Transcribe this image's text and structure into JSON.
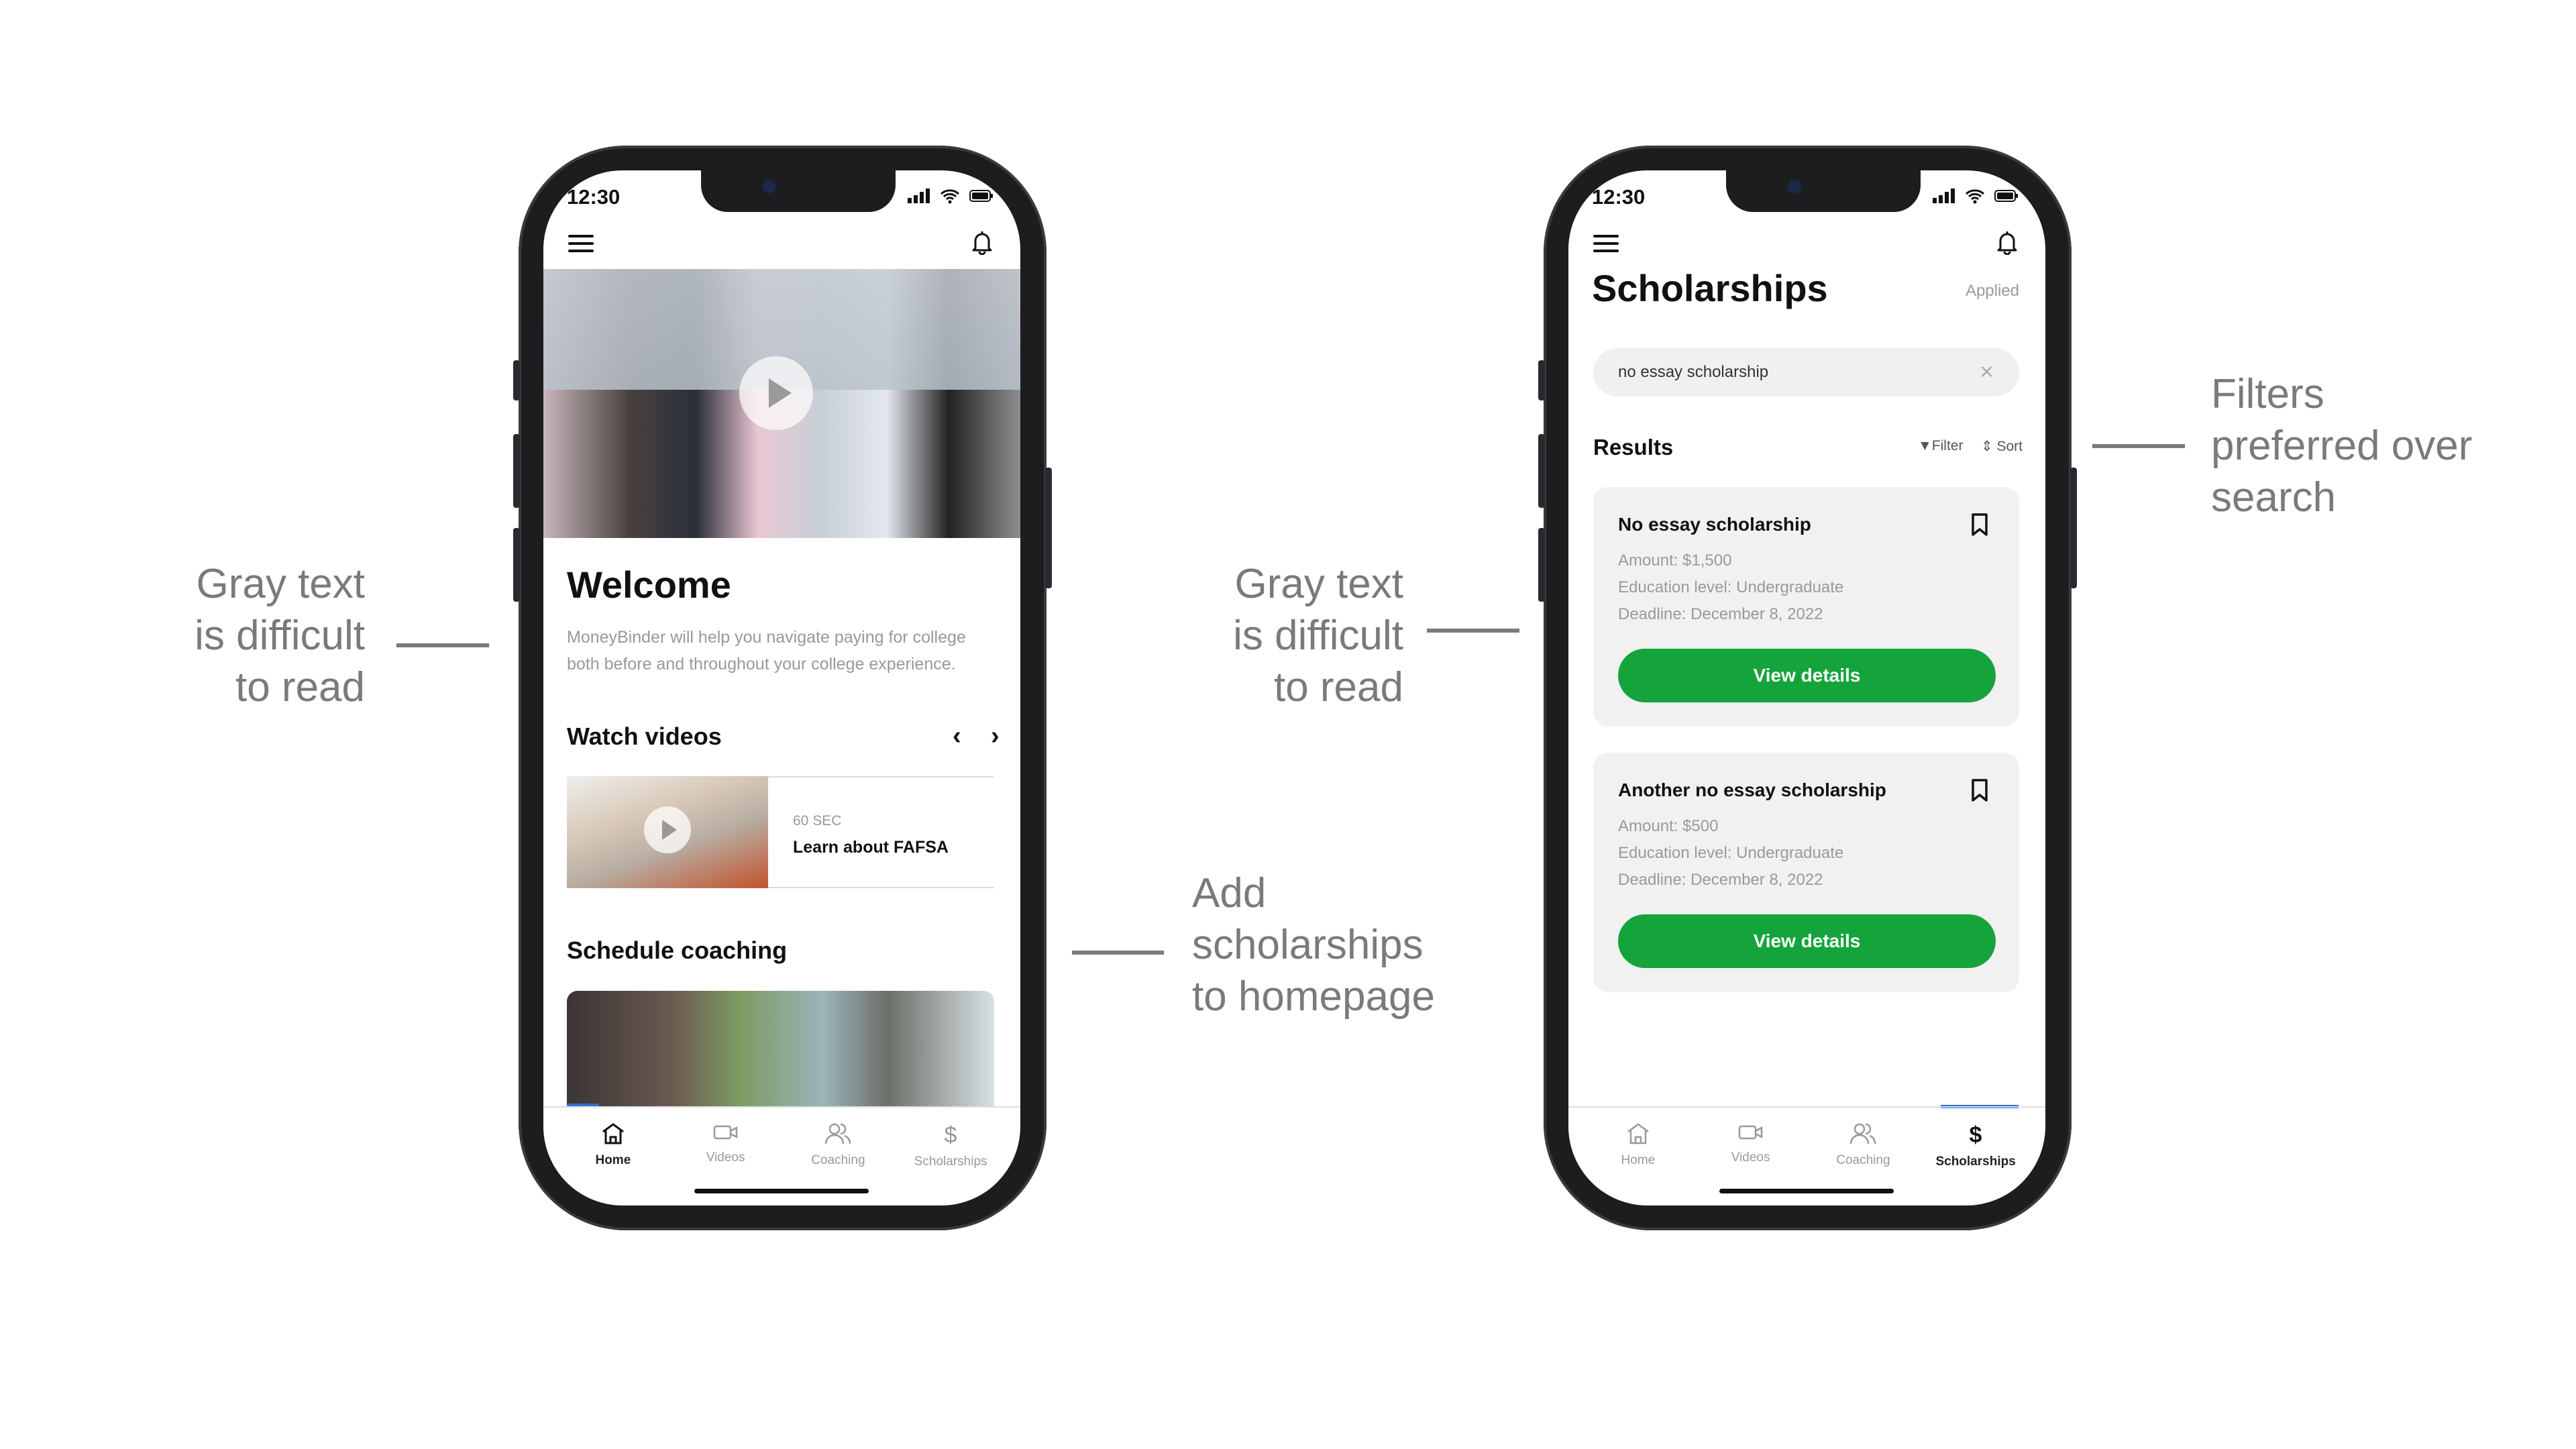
{
  "annotations": [
    {
      "lines": [
        "Gray text",
        "is difficult",
        "to read"
      ]
    },
    {
      "lines": [
        "Gray text",
        "is difficult",
        "to read"
      ]
    },
    {
      "lines": [
        "Add",
        "scholarships",
        "to homepage"
      ]
    },
    {
      "lines": [
        "Filters",
        "preferred over",
        "search"
      ]
    }
  ],
  "status_time": "12:30",
  "nav": [
    "Home",
    "Videos",
    "Coaching",
    "Scholarships"
  ],
  "home": {
    "title": "Welcome",
    "description": "MoneyBinder will help you navigate paying for college both before and throughout your college experience.",
    "videos_heading": "Watch videos",
    "video": {
      "duration": "60 SEC",
      "title": "Learn about FAFSA"
    },
    "coaching_heading": "Schedule coaching"
  },
  "scholarships": {
    "title": "Scholarships",
    "applied_link": "Applied",
    "search_value": "no essay scholarship",
    "results_heading": "Results",
    "filter_label": "Filter",
    "sort_label": "Sort",
    "items": [
      {
        "name": "No essay scholarship",
        "amount": "Amount: $1,500",
        "level": "Education level: Undergraduate",
        "deadline": "Deadline: December 8, 2022",
        "button": "View details"
      },
      {
        "name": "Another no essay scholarship",
        "amount": "Amount: $500",
        "level": "Education level: Undergraduate",
        "deadline": "Deadline: December 8, 2022",
        "button": "View details"
      }
    ]
  },
  "colors": {
    "accent_green": "#15a43c",
    "active_tab_blue": "#2f6fd6",
    "annotation_gray": "#7a7a7a"
  }
}
